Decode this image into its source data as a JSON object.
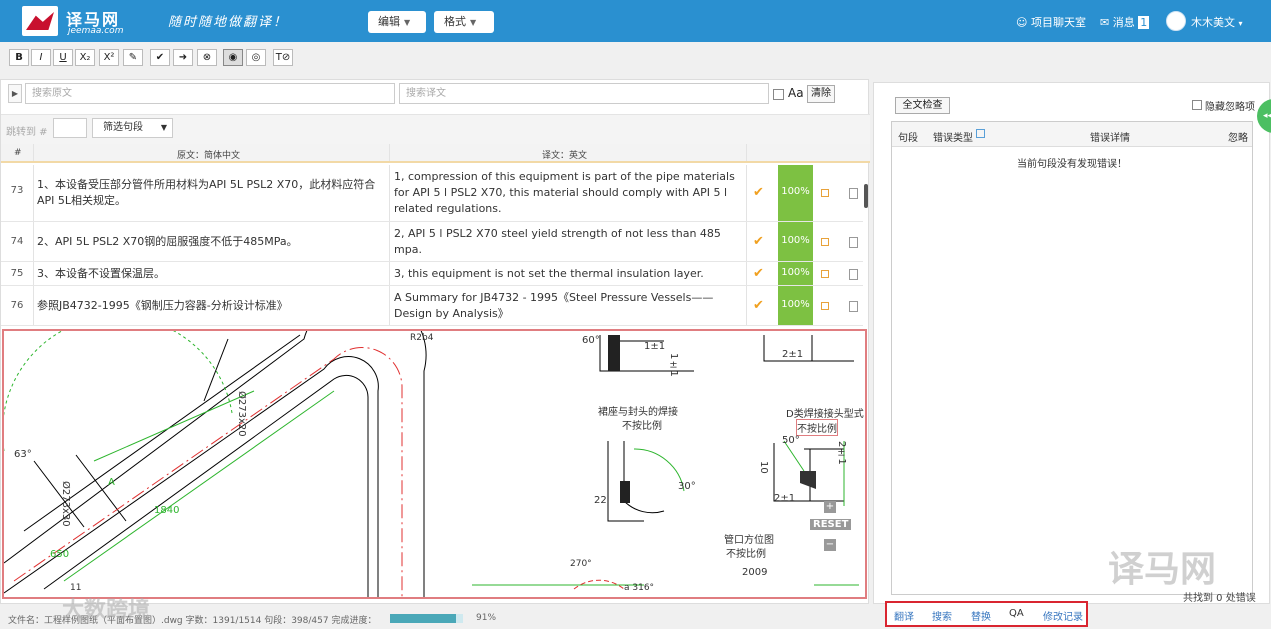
{
  "header": {
    "brand": "译马网",
    "brand_sub": "jeemaa.com",
    "slogan": "随时随地做翻译！",
    "menu_edit": "编辑",
    "menu_format": "格式",
    "chatroom": "项目聊天室",
    "messages": "消息",
    "message_count": "1",
    "user": "木木美文"
  },
  "toolbar": {
    "buttons": [
      "B",
      "I",
      "U",
      "X₂",
      "X²",
      "✎",
      "✔",
      "➜",
      "⊗",
      "◉",
      "◎",
      "T⊘"
    ]
  },
  "search": {
    "source_placeholder": "搜索原文",
    "target_placeholder": "搜索译文",
    "case_label": "Aa",
    "clear_label": "清除"
  },
  "filter": {
    "jump_label": "跳转到 #",
    "filter_label": "筛选句段"
  },
  "grid": {
    "headers": {
      "num": "#",
      "source": "原文：简体中文",
      "target": "译文：英文"
    },
    "rows": [
      {
        "num": "73",
        "source": "1、本设备受压部分管件所用材料为API 5L PSL2 X70，此材料应符合API 5L相关规定。",
        "target": "1, compression of this equipment is part of the pipe materials for API 5 l PSL2 X70, this material should comply with API 5 l related regulations.",
        "match": "100%"
      },
      {
        "num": "74",
        "source": "2、API 5L PSL2 X70钢的屈服强度不低于485MPa。",
        "target": "2, API 5 l PSL2 X70 steel yield strength of not less than 485 mpa.",
        "match": "100%"
      },
      {
        "num": "75",
        "source": "3、本设备不设置保温层。",
        "target": "3, this equipment is not set the thermal insulation layer.",
        "match": "100%"
      },
      {
        "num": "76",
        "source": "参照JB4732-1995《钢制压力容器-分析设计标准》",
        "target": "A Summary for JB4732 - 1995《Steel Pressure Vessels——Design by Analysis》",
        "match": "100%"
      }
    ]
  },
  "drawing": {
    "labels": [
      "60°",
      "R2b4",
      "1±1",
      "1±1",
      "Ø273x20",
      "2±1",
      "裙座与封头的焊接",
      "不按比例",
      "D类焊接接头型式",
      "不按比例",
      "50°",
      "63°",
      "Ø273x30",
      "1840",
      "10",
      "2±1",
      "22",
      "30°",
      "2±1",
      "RESET",
      "管口方位图",
      "不按比例",
      "2009",
      "650",
      "270°",
      "a 316°",
      "11",
      "A"
    ]
  },
  "status": {
    "text": "文件名：工程样例图纸（平面布置图）.dwg  字数：1391/1514  句段：398/457  完成进度：",
    "progress": 0.91,
    "progress_label": "91%"
  },
  "qa": {
    "full_check": "全文检查",
    "hide_ignored": "隐藏忽略项",
    "headers": [
      "句段",
      "错误类型",
      "错误详情",
      "忽略"
    ],
    "empty_message": "当前句段没有发现错误！",
    "found": "共找到 0 处错误"
  },
  "tabs": [
    "翻译",
    "搜索",
    "替换",
    "QA",
    "修改记录"
  ],
  "watermarks": {
    "left": "大数跨境",
    "right": "译马网"
  },
  "colors": {
    "header": "#2a90d0",
    "match": "#7dc142",
    "highlight": "#d92530"
  }
}
